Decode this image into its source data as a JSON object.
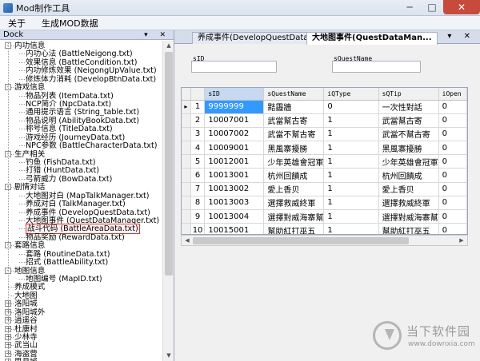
{
  "window": {
    "title": "Mod制作工具"
  },
  "menu": {
    "items": [
      "关于",
      "生成MOD数据"
    ]
  },
  "dock": {
    "title": "Dock",
    "controls": "▾ ✕"
  },
  "tree": [
    {
      "label": "内功信息",
      "level": 0,
      "expand": "-"
    },
    {
      "label": "内功心法 (BattleNeigong.txt)",
      "level": 1
    },
    {
      "label": "效果信息 (BattleCondition.txt)",
      "level": 1
    },
    {
      "label": "内功修炼效果 (NeigongUpValue.txt)",
      "level": 1
    },
    {
      "label": "修炼体力消耗 (DevelopBtnData.txt)",
      "level": 1
    },
    {
      "label": "游戏信息",
      "level": 0,
      "expand": "-"
    },
    {
      "label": "物品列表 (ItemData.txt)",
      "level": 1
    },
    {
      "label": "NCP简介 (NpcData.txt)",
      "level": 1
    },
    {
      "label": "通用提示语言 (String_table.txt)",
      "level": 1
    },
    {
      "label": "物品说明 (AbilityBookData.txt)",
      "level": 1
    },
    {
      "label": "称号信息 (TitleData.txt)",
      "level": 1
    },
    {
      "label": "游戏经历 (JourneyData.txt)",
      "level": 1
    },
    {
      "label": "NPC参数 (BattleCharacterData.txt)",
      "level": 1
    },
    {
      "label": "生产相关",
      "level": 0,
      "expand": "-"
    },
    {
      "label": "钓鱼 (FishData.txt)",
      "level": 1
    },
    {
      "label": "打猎 (HuntData.txt)",
      "level": 1
    },
    {
      "label": "弓箭威力 (BowData.txt)",
      "level": 1
    },
    {
      "label": "剧情对话",
      "level": 0,
      "expand": "-"
    },
    {
      "label": "大地图对白 (MapTalkManager.txt)",
      "level": 1
    },
    {
      "label": "养成对白 (TalkManager.txt)",
      "level": 1
    },
    {
      "label": "养成事件 (DevelopQuestData.txt)",
      "level": 1
    },
    {
      "label": "大地图事件 (QuestDataManager.txt)",
      "level": 1
    },
    {
      "label": "战斗代码 (BattleAreaData.txt)",
      "level": 1,
      "selected": true
    },
    {
      "label": "物品奖励 (RewardData.txt)",
      "level": 1
    },
    {
      "label": "套路信息",
      "level": 0,
      "expand": "-"
    },
    {
      "label": "套路 (RoutineData.txt)",
      "level": 1
    },
    {
      "label": "招式 (BattleAbility.txt)",
      "level": 1
    },
    {
      "label": "地图信息",
      "level": 0,
      "expand": "-"
    },
    {
      "label": "地图编号 (MapID.txt)",
      "level": 1
    },
    {
      "label": "养成模式",
      "level": 0
    },
    {
      "label": "大地图",
      "level": 0
    },
    {
      "label": "洛阳城",
      "level": 0,
      "expand": "+"
    },
    {
      "label": "洛阳城外",
      "level": 0,
      "expand": "+"
    },
    {
      "label": "逍遥谷",
      "level": 0,
      "expand": "+"
    },
    {
      "label": "杜康村",
      "level": 0,
      "expand": "+"
    },
    {
      "label": "少林寺",
      "level": 0,
      "expand": "+"
    },
    {
      "label": "武当山",
      "level": 0,
      "expand": "+"
    },
    {
      "label": "海盗营",
      "level": 0,
      "expand": "+"
    },
    {
      "label": "思月城",
      "level": 0,
      "expand": "+"
    }
  ],
  "tabs": [
    {
      "label": "养成事件(DevelopQuestData.txt)"
    },
    {
      "label": "大地图事件(QuestDataMan..."
    }
  ],
  "tab_controls": "▾ ✕",
  "filters": {
    "sid_label": "sID",
    "squestname_label": "sQuestName"
  },
  "grid": {
    "columns": [
      "",
      "",
      "sID",
      "sQuestName",
      "iQType",
      "sQTip",
      "iOpen"
    ],
    "rows": [
      [
        "▸",
        "1",
        "9999999",
        "黠霾牆",
        "0",
        "一次性對話",
        "0"
      ],
      [
        "",
        "2",
        "10007001",
        "武當幫古寄",
        "1",
        "武當幫古寄",
        "0"
      ],
      [
        "",
        "3",
        "10007002",
        "武當不幫古寄",
        "1",
        "武當不幫古寄",
        "0"
      ],
      [
        "",
        "4",
        "10009001",
        "黑風寨擾勝",
        "1",
        "黑風寨擾勝",
        "0"
      ],
      [
        "",
        "5",
        "10012001",
        "少年英雄會冠軍",
        "1",
        "少年英雄會冠軍",
        "0"
      ],
      [
        "",
        "6",
        "10013001",
        "杭州回饋成",
        "1",
        "杭州回饋成",
        "0"
      ],
      [
        "",
        "7",
        "10013002",
        "愛上香贝",
        "1",
        "愛上香贝",
        "0"
      ],
      [
        "",
        "8",
        "10013003",
        "選擇救威終軍",
        "1",
        "選擇救威終軍",
        "0"
      ],
      [
        "",
        "9",
        "10013004",
        "選擇對威海寨幫",
        "1",
        "選擇對威海寨幫",
        "0"
      ],
      [
        "",
        "10",
        "10015001",
        "幫助紅打巫五",
        "1",
        "幫助紅打巫五",
        "0"
      ]
    ]
  },
  "watermark": {
    "title": "当下软件园",
    "url": "www.downxia.com"
  }
}
